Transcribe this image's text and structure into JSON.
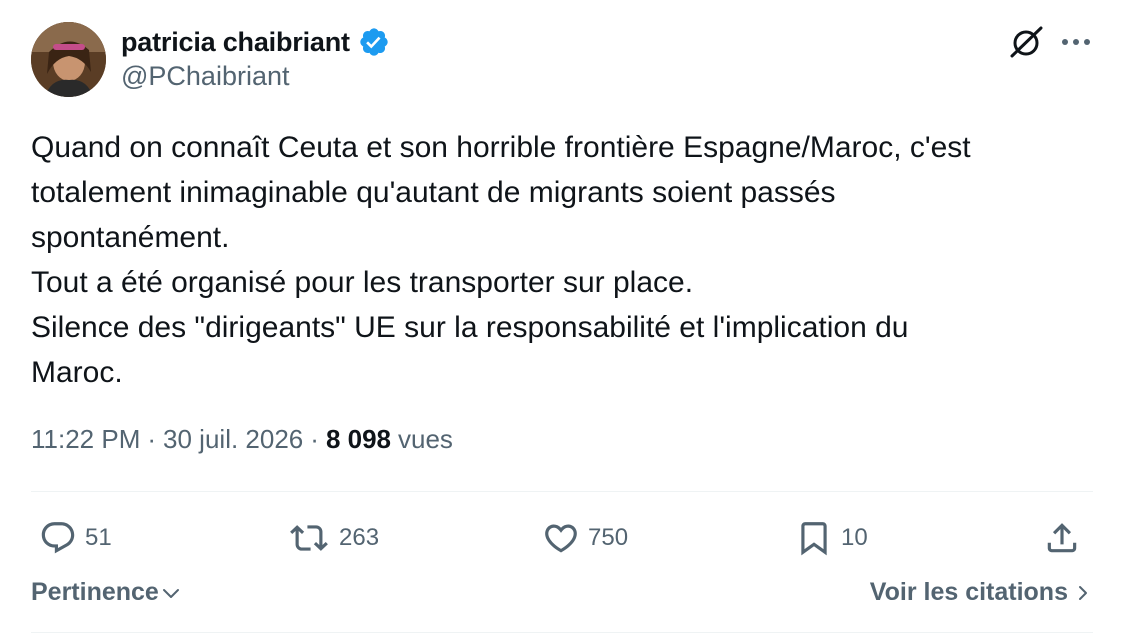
{
  "author": {
    "display_name": "patricia chaibriant",
    "handle": "@PChaibriant",
    "verified": true
  },
  "tweet": {
    "lines": [
      "Quand on connaît Ceuta et son horrible frontière Espagne/Maroc, c'est",
      "totalement inimaginable qu'autant de migrants soient passés",
      "spontanément.",
      "Tout a été organisé pour les transporter sur place.",
      "Silence des \"dirigeants\" UE sur la responsabilité et l'implication du",
      "Maroc."
    ]
  },
  "meta": {
    "time": "11:22 PM",
    "separator": "·",
    "date": "30 juil. 2026",
    "views_count": "8 098",
    "views_label": "vues"
  },
  "actions": {
    "replies": "51",
    "reposts": "263",
    "likes": "750",
    "bookmarks": "10"
  },
  "footer": {
    "sort_label": "Pertinence",
    "quotes_label": "Voir les citations"
  },
  "icons": {
    "verified": "verified-badge-icon",
    "grok": "grok-icon",
    "more": "more-dots-icon",
    "reply": "reply-icon",
    "repost": "repost-icon",
    "like": "heart-icon",
    "bookmark": "bookmark-icon",
    "share": "share-icon"
  },
  "colors": {
    "text_primary": "#0f1419",
    "text_secondary": "#536471",
    "verified_blue": "#1d9bf0",
    "divider": "#eff3f4"
  }
}
